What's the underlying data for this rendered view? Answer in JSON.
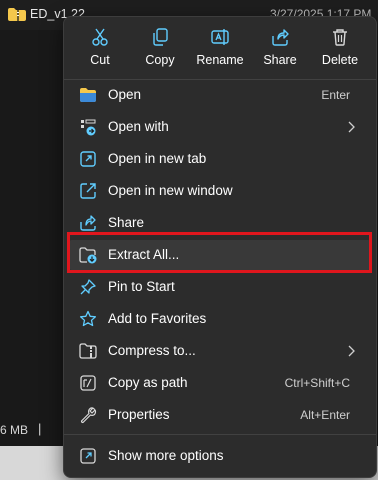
{
  "background": {
    "file_name": "ED_v1.22",
    "file_date": "3/27/2025 1:17 PM",
    "status_size": "6 MB",
    "status_separator": "|"
  },
  "toolbar": {
    "cut_label": "Cut",
    "copy_label": "Copy",
    "rename_label": "Rename",
    "share_label": "Share",
    "delete_label": "Delete"
  },
  "menu": {
    "open": {
      "label": "Open",
      "shortcut": "Enter"
    },
    "open_with": {
      "label": "Open with"
    },
    "open_new_tab": {
      "label": "Open in new tab"
    },
    "open_new_window": {
      "label": "Open in new window"
    },
    "share": {
      "label": "Share"
    },
    "extract_all": {
      "label": "Extract All..."
    },
    "pin_to_start": {
      "label": "Pin to Start"
    },
    "add_to_favorites": {
      "label": "Add to Favorites"
    },
    "compress_to": {
      "label": "Compress to..."
    },
    "copy_as_path": {
      "label": "Copy as path",
      "shortcut": "Ctrl+Shift+C"
    },
    "properties": {
      "label": "Properties",
      "shortcut": "Alt+Enter"
    },
    "show_more_options": {
      "label": "Show more options"
    }
  },
  "colors": {
    "accent_blue": "#60cdff",
    "folder_yellow": "#f5c84c",
    "highlight_red": "#e0161d",
    "menu_bg": "#2c2c2c"
  },
  "icons": [
    "folder-icon",
    "cut-icon",
    "copy-icon",
    "rename-icon",
    "share-icon",
    "delete-icon",
    "open-with-icon",
    "new-tab-icon",
    "new-window-icon",
    "extract-icon",
    "pin-icon",
    "star-icon",
    "compress-icon",
    "copy-path-icon",
    "wrench-icon",
    "more-options-icon",
    "chevron-right-icon"
  ]
}
